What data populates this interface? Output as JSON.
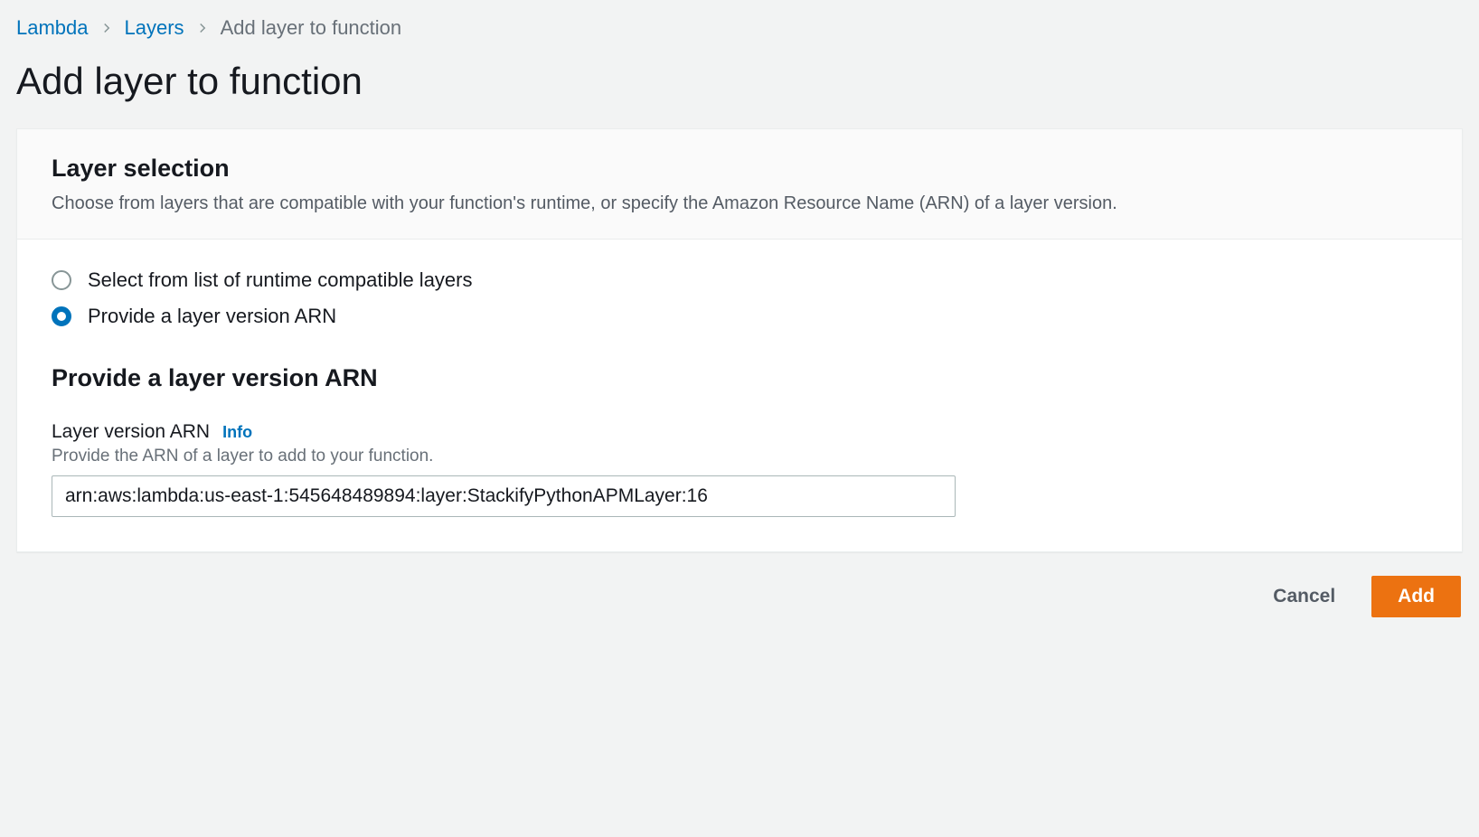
{
  "breadcrumb": {
    "items": [
      {
        "label": "Lambda"
      },
      {
        "label": "Layers"
      }
    ],
    "current": "Add layer to function"
  },
  "page": {
    "title": "Add layer to function"
  },
  "panel": {
    "title": "Layer selection",
    "description": "Choose from layers that are compatible with your function's runtime, or specify the Amazon Resource Name (ARN) of a layer version."
  },
  "radio": {
    "option1": "Select from list of runtime compatible layers",
    "option2": "Provide a layer version ARN"
  },
  "section": {
    "heading": "Provide a layer version ARN"
  },
  "field": {
    "label": "Layer version ARN",
    "info": "Info",
    "help": "Provide the ARN of a layer to add to your function.",
    "value": "arn:aws:lambda:us-east-1:545648489894:layer:StackifyPythonAPMLayer:16"
  },
  "buttons": {
    "cancel": "Cancel",
    "add": "Add"
  }
}
